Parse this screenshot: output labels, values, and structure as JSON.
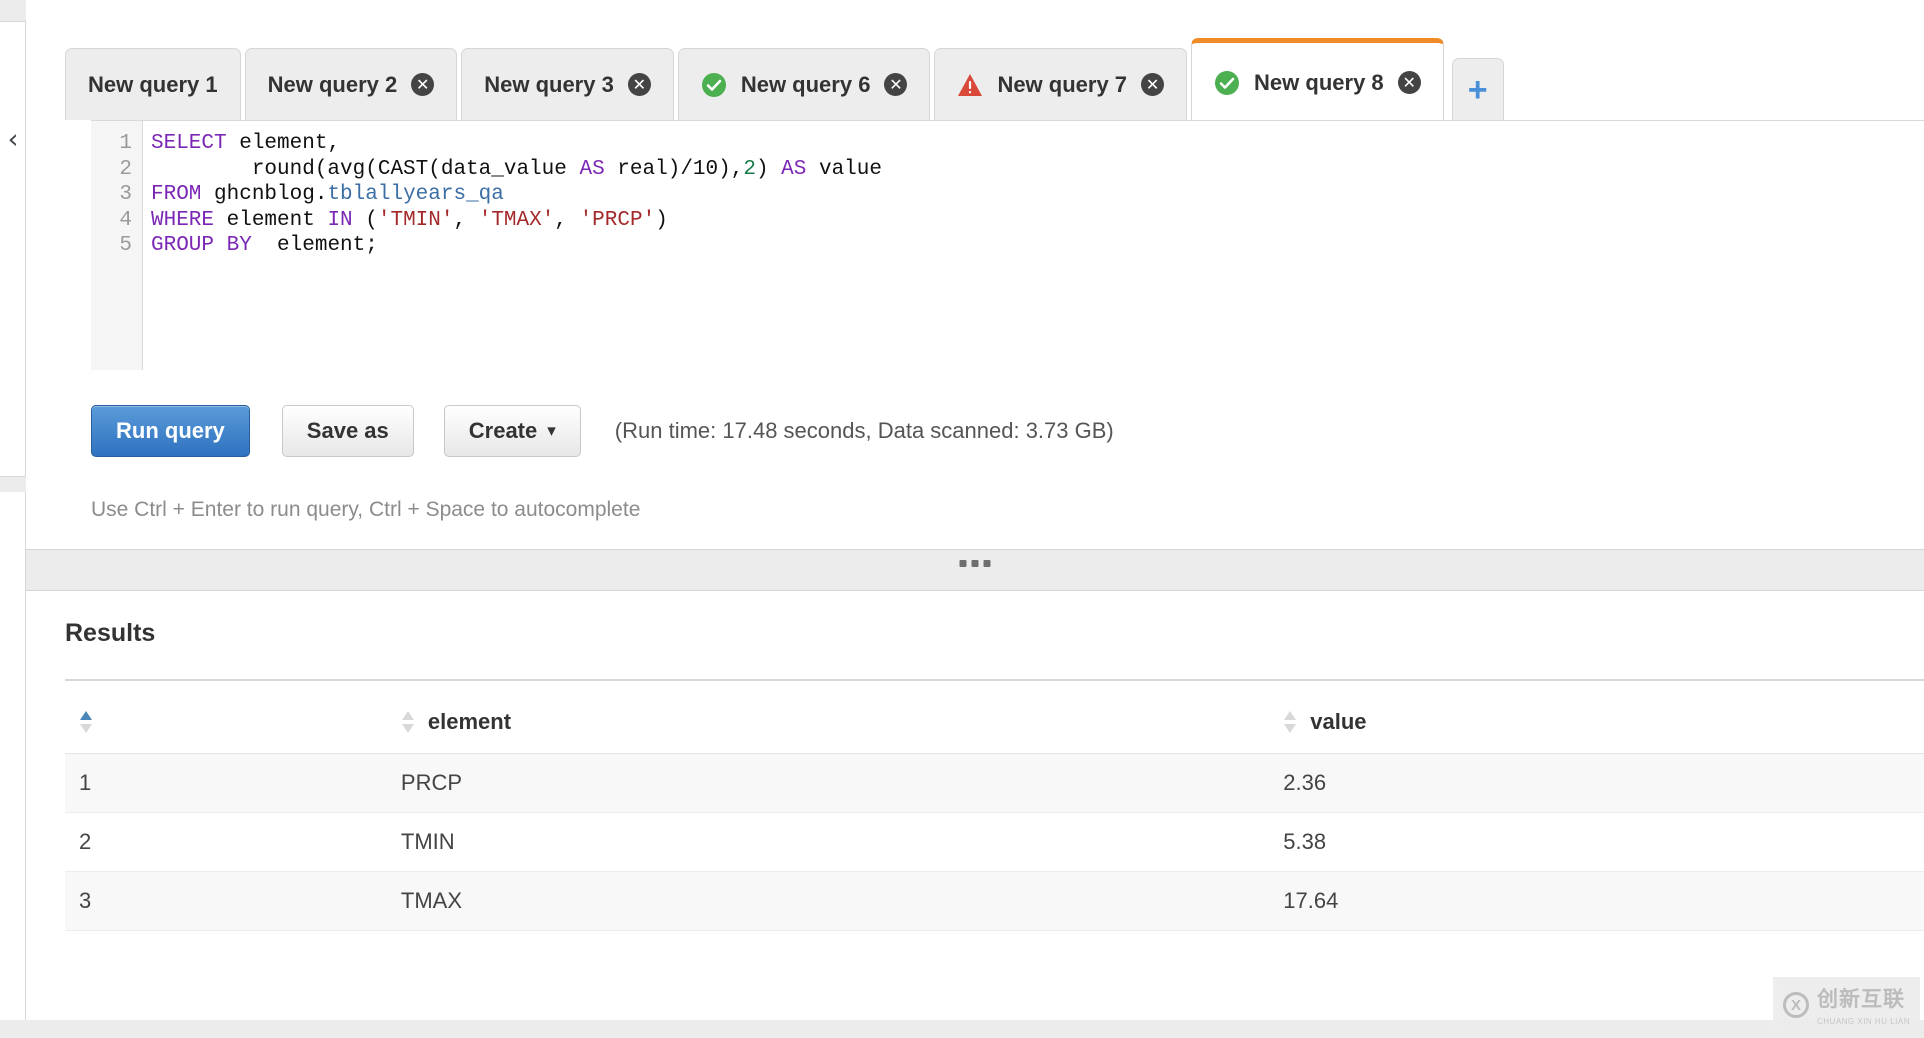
{
  "left_rail": {
    "collapse_icon": "chevron-left"
  },
  "tabs": {
    "items": [
      {
        "label": "New query 1",
        "status": "none",
        "closable": false,
        "active": false
      },
      {
        "label": "New query 2",
        "status": "none",
        "closable": true,
        "active": false
      },
      {
        "label": "New query 3",
        "status": "none",
        "closable": true,
        "active": false
      },
      {
        "label": "New query 6",
        "status": "success",
        "closable": true,
        "active": false
      },
      {
        "label": "New query 7",
        "status": "warning",
        "closable": true,
        "active": false
      },
      {
        "label": "New query 8",
        "status": "success",
        "closable": true,
        "active": true
      }
    ],
    "add_label": "+",
    "close_glyph": "✕",
    "active_accent_color": "#ef8c28",
    "success_color": "#4caf50",
    "warning_color": "#d9493a"
  },
  "editor": {
    "line_numbers": [
      "1",
      "2",
      "3",
      "4",
      "5"
    ],
    "lines": [
      {
        "n": "1",
        "tokens": [
          {
            "t": "SELECT",
            "c": "kw"
          },
          {
            "t": " element,",
            "c": ""
          }
        ]
      },
      {
        "n": "2",
        "tokens": [
          {
            "t": "        round(avg(CAST(data_value ",
            "c": ""
          },
          {
            "t": "AS",
            "c": "kw"
          },
          {
            "t": " real)/10),",
            "c": ""
          },
          {
            "t": "2",
            "c": "num"
          },
          {
            "t": ") ",
            "c": ""
          },
          {
            "t": "AS",
            "c": "kw"
          },
          {
            "t": " value",
            "c": ""
          }
        ]
      },
      {
        "n": "3",
        "tokens": [
          {
            "t": "FROM",
            "c": "kw"
          },
          {
            "t": " ghcnblog.",
            "c": ""
          },
          {
            "t": "tblallyears_qa",
            "c": "tbl"
          }
        ]
      },
      {
        "n": "4",
        "tokens": [
          {
            "t": "WHERE",
            "c": "kw"
          },
          {
            "t": " element ",
            "c": ""
          },
          {
            "t": "IN",
            "c": "kw"
          },
          {
            "t": " (",
            "c": ""
          },
          {
            "t": "'TMIN'",
            "c": "str"
          },
          {
            "t": ", ",
            "c": ""
          },
          {
            "t": "'TMAX'",
            "c": "str"
          },
          {
            "t": ", ",
            "c": ""
          },
          {
            "t": "'PRCP'",
            "c": "str"
          },
          {
            "t": ")",
            "c": ""
          }
        ]
      },
      {
        "n": "5",
        "tokens": [
          {
            "t": "GROUP BY",
            "c": "kw"
          },
          {
            "t": "  element;",
            "c": ""
          }
        ]
      }
    ],
    "plain_text": "SELECT element,\n        round(avg(CAST(data_value AS real)/10),2) AS value\nFROM ghcnblog.tblallyears_qa\nWHERE element IN ('TMIN', 'TMAX', 'PRCP')\nGROUP BY  element;"
  },
  "actions": {
    "run_label": "Run query",
    "save_label": "Save as",
    "create_label": "Create",
    "create_caret": "⌄",
    "run_meta": "(Run time: 17.48 seconds, Data scanned: 3.73 GB)",
    "hint": "Use Ctrl + Enter to run query, Ctrl + Space to autocomplete"
  },
  "splitter": {
    "handle": "resize-dots"
  },
  "results": {
    "title": "Results",
    "columns": [
      {
        "label": "",
        "sort": "asc"
      },
      {
        "label": "element",
        "sort": "none"
      },
      {
        "label": "value",
        "sort": "none"
      }
    ],
    "rows": [
      {
        "idx": "1",
        "element": "PRCP",
        "value": "2.36"
      },
      {
        "idx": "2",
        "element": "TMIN",
        "value": "5.38"
      },
      {
        "idx": "3",
        "element": "TMAX",
        "value": "17.64"
      }
    ]
  },
  "watermark": {
    "mark": "X",
    "cn": "创新互联",
    "en": "CHUANG XIN HU LIAN"
  }
}
